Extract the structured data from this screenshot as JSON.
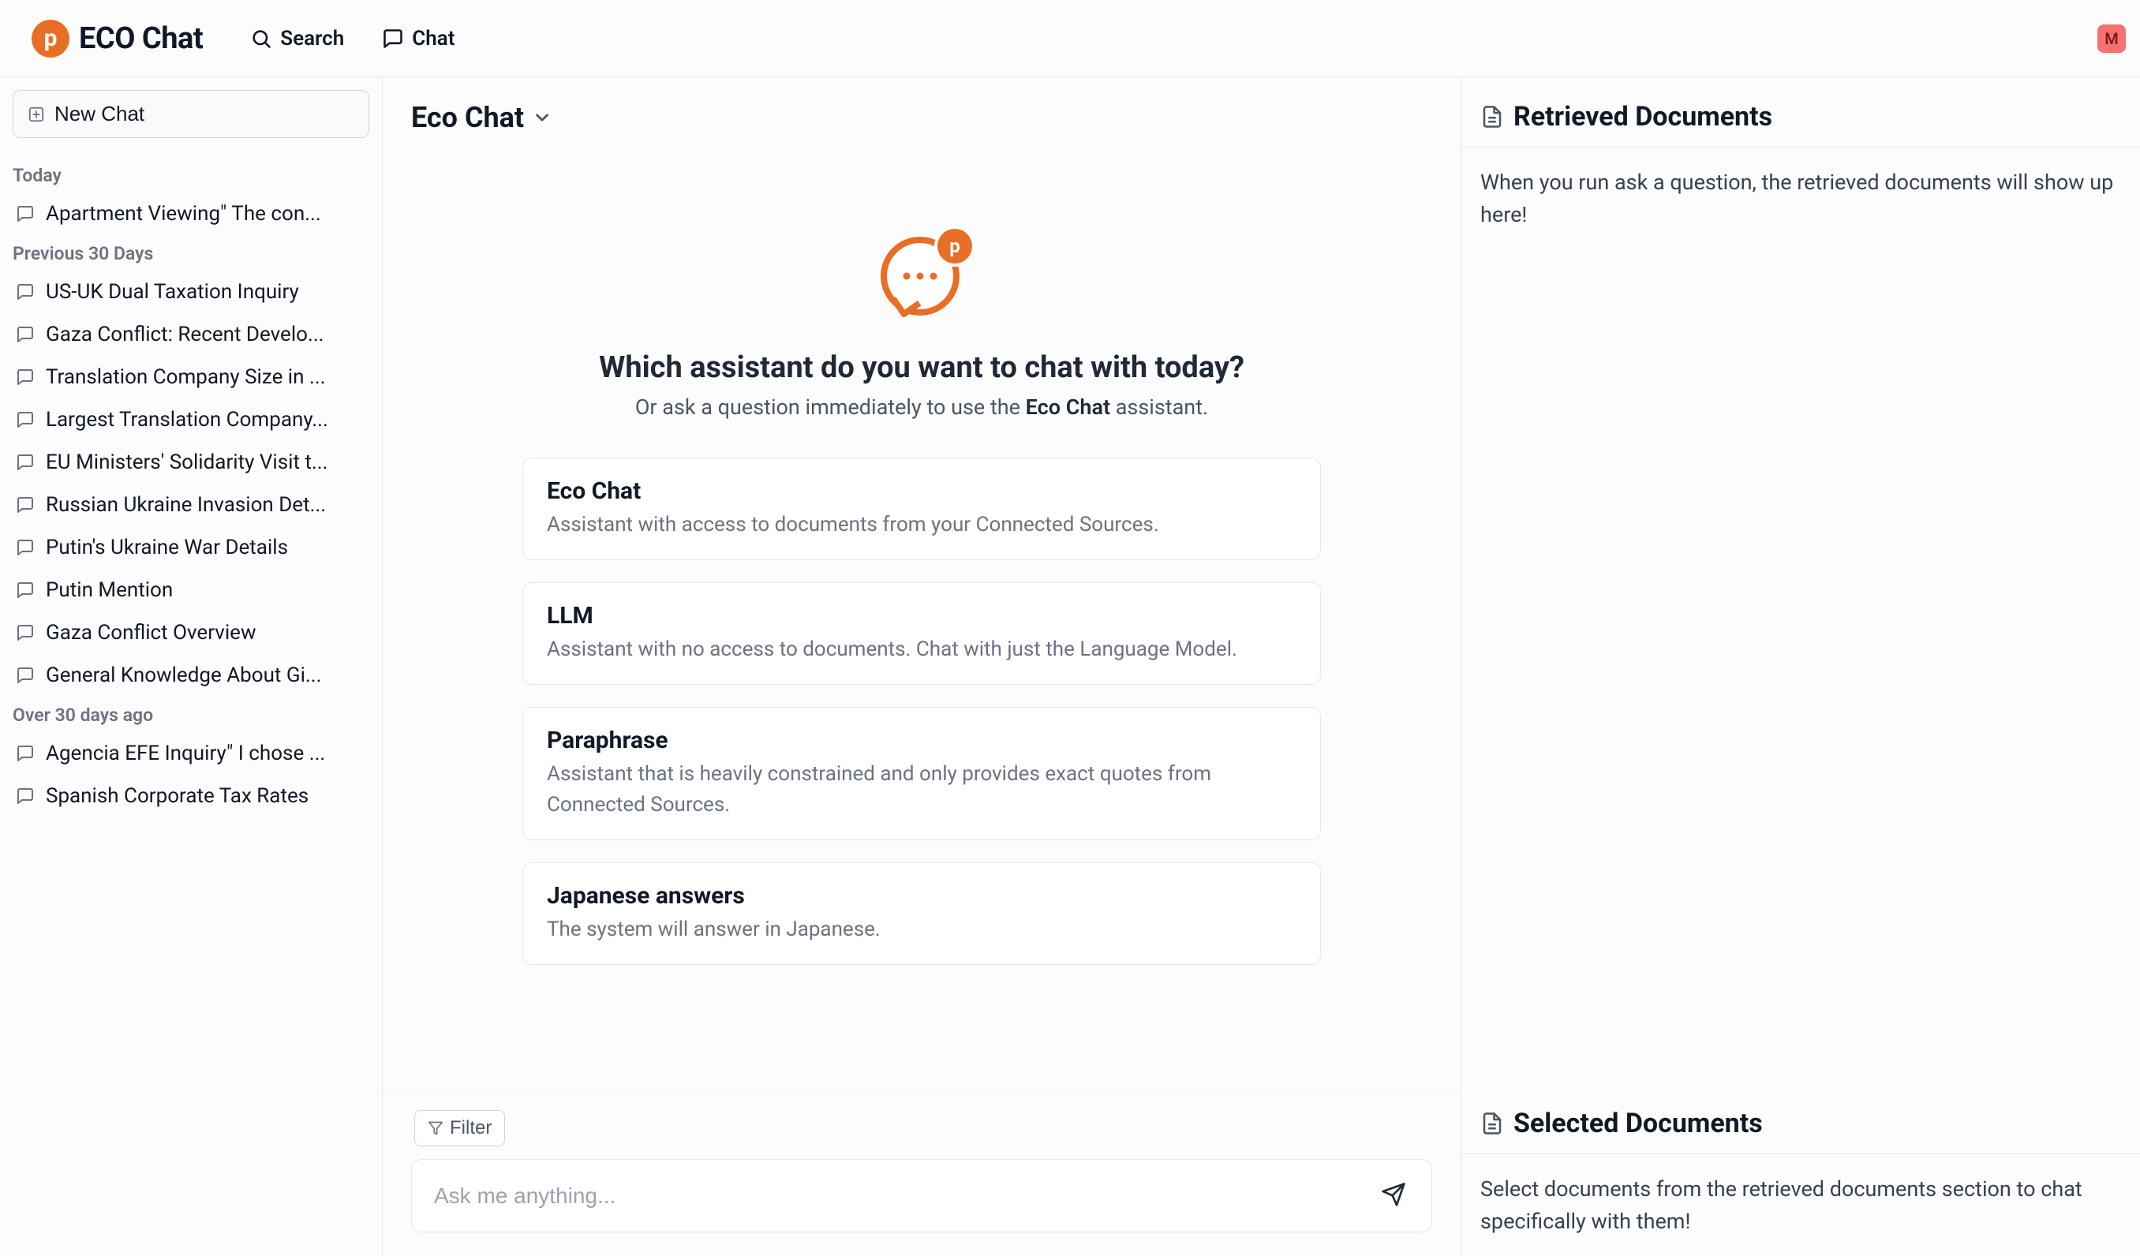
{
  "brand": {
    "name": "ECO Chat",
    "logo_letter": "p"
  },
  "nav": {
    "search": "Search",
    "chat": "Chat"
  },
  "avatar": {
    "letter": "M"
  },
  "sidebar": {
    "new_chat": "New Chat",
    "groups": [
      {
        "label": "Today",
        "items": [
          "Apartment Viewing\" The con..."
        ]
      },
      {
        "label": "Previous 30 Days",
        "items": [
          "US-UK Dual Taxation Inquiry",
          "Gaza Conflict: Recent Develo...",
          "Translation Company Size in ...",
          "Largest Translation Company...",
          "EU Ministers' Solidarity Visit t...",
          "Russian Ukraine Invasion Det...",
          "Putin's Ukraine War Details",
          "Putin Mention",
          "Gaza Conflict Overview",
          "General Knowledge About Gi..."
        ]
      },
      {
        "label": "Over 30 days ago",
        "items": [
          "Agencia EFE Inquiry\" I chose ...",
          "Spanish Corporate Tax Rates"
        ]
      }
    ]
  },
  "center": {
    "title": "Eco Chat",
    "hero_badge": "p",
    "hero_title": "Which assistant do you want to chat with today?",
    "hero_sub_prefix": "Or ask a question immediately to use the ",
    "hero_sub_strong": "Eco Chat",
    "hero_sub_suffix": " assistant.",
    "assistants": [
      {
        "title": "Eco Chat",
        "desc": "Assistant with access to documents from your Connected Sources."
      },
      {
        "title": "LLM",
        "desc": "Assistant with no access to documents. Chat with just the Language Model."
      },
      {
        "title": "Paraphrase",
        "desc": "Assistant that is heavily constrained and only provides exact quotes from Connected Sources."
      },
      {
        "title": "Japanese answers",
        "desc": "The system will answer in Japanese."
      }
    ],
    "filter_label": "Filter",
    "input_placeholder": "Ask me anything..."
  },
  "right": {
    "retrieved_title": "Retrieved Documents",
    "retrieved_body": "When you run ask a question, the retrieved documents will show up here!",
    "selected_title": "Selected Documents",
    "selected_body": "Select documents from the retrieved documents section to chat specifically with them!"
  }
}
